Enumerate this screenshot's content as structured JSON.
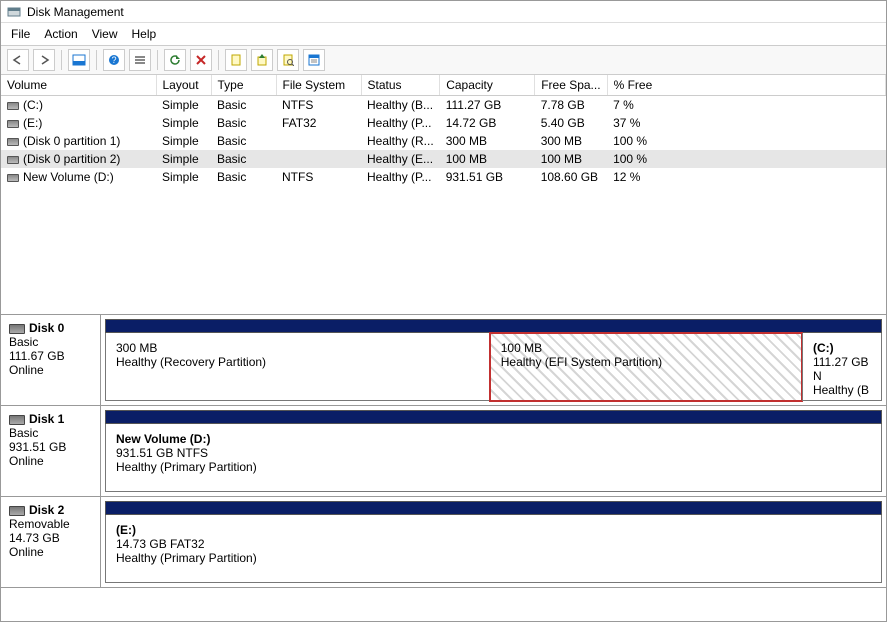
{
  "title": "Disk Management",
  "menu": {
    "file": "File",
    "action": "Action",
    "view": "View",
    "help": "Help"
  },
  "columns": {
    "volume": "Volume",
    "layout": "Layout",
    "type": "Type",
    "fs": "File System",
    "status": "Status",
    "capacity": "Capacity",
    "free": "Free Spa...",
    "pct": "% Free"
  },
  "vols": [
    {
      "name": "(C:)",
      "layout": "Simple",
      "type": "Basic",
      "fs": "NTFS",
      "status": "Healthy (B...",
      "cap": "111.27 GB",
      "free": "7.78 GB",
      "pct": "7 %",
      "sel": false
    },
    {
      "name": "(E:)",
      "layout": "Simple",
      "type": "Basic",
      "fs": "FAT32",
      "status": "Healthy (P...",
      "cap": "14.72 GB",
      "free": "5.40 GB",
      "pct": "37 %",
      "sel": false
    },
    {
      "name": "(Disk 0 partition 1)",
      "layout": "Simple",
      "type": "Basic",
      "fs": "",
      "status": "Healthy (R...",
      "cap": "300 MB",
      "free": "300 MB",
      "pct": "100 %",
      "sel": false
    },
    {
      "name": "(Disk 0 partition 2)",
      "layout": "Simple",
      "type": "Basic",
      "fs": "",
      "status": "Healthy (E...",
      "cap": "100 MB",
      "free": "100 MB",
      "pct": "100 %",
      "sel": true
    },
    {
      "name": "New Volume (D:)",
      "layout": "Simple",
      "type": "Basic",
      "fs": "NTFS",
      "status": "Healthy (P...",
      "cap": "931.51 GB",
      "free": "108.60 GB",
      "pct": "12 %",
      "sel": false
    }
  ],
  "disks": [
    {
      "name": "Disk 0",
      "type": "Basic",
      "size": "111.67 GB",
      "state": "Online",
      "parts": [
        {
          "title": "",
          "line1": "300 MB",
          "line2": "Healthy (Recovery Partition)",
          "flex": 50,
          "hatched": false,
          "hl": false
        },
        {
          "title": "",
          "line1": "100 MB",
          "line2": "Healthy (EFI System Partition)",
          "flex": 40,
          "hatched": true,
          "hl": true
        },
        {
          "title": "(C:)",
          "line1": "111.27 GB N",
          "line2": "Healthy (B",
          "flex": 8,
          "hatched": false,
          "hl": false
        }
      ]
    },
    {
      "name": "Disk 1",
      "type": "Basic",
      "size": "931.51 GB",
      "state": "Online",
      "parts": [
        {
          "title": "New Volume  (D:)",
          "line1": "931.51 GB NTFS",
          "line2": "Healthy (Primary Partition)",
          "flex": 100,
          "hatched": false,
          "hl": false
        }
      ]
    },
    {
      "name": "Disk 2",
      "type": "Removable",
      "size": "14.73 GB",
      "state": "Online",
      "parts": [
        {
          "title": "(E:)",
          "line1": "14.73 GB FAT32",
          "line2": "Healthy (Primary Partition)",
          "flex": 100,
          "hatched": false,
          "hl": false
        }
      ]
    }
  ]
}
